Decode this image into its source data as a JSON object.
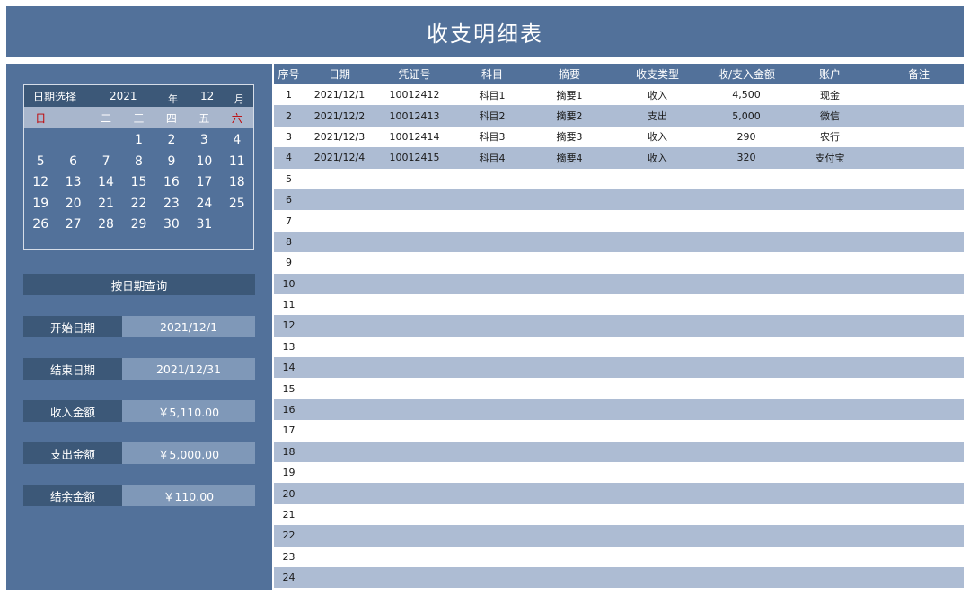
{
  "title": "收支明细表",
  "calendar": {
    "label": "日期选择",
    "year": "2021",
    "year_unit": "年",
    "month": "12",
    "month_unit": "月",
    "weekdays": [
      "日",
      "一",
      "二",
      "三",
      "四",
      "五",
      "六"
    ],
    "cells": [
      "",
      "",
      "",
      "1",
      "2",
      "3",
      "4",
      "5",
      "6",
      "7",
      "8",
      "9",
      "10",
      "11",
      "12",
      "13",
      "14",
      "15",
      "16",
      "17",
      "18",
      "19",
      "20",
      "21",
      "22",
      "23",
      "24",
      "25",
      "26",
      "27",
      "28",
      "29",
      "30",
      "31",
      "",
      ""
    ]
  },
  "query_button": "按日期查询",
  "summary": [
    {
      "label": "开始日期",
      "value": "2021/12/1"
    },
    {
      "label": "结束日期",
      "value": "2021/12/31"
    },
    {
      "label": "收入金额",
      "value": "￥5,110.00"
    },
    {
      "label": "支出金额",
      "value": "￥5,000.00"
    },
    {
      "label": "结余金额",
      "value": "￥110.00"
    }
  ],
  "table": {
    "headers": [
      "序号",
      "日期",
      "凭证号",
      "科目",
      "摘要",
      "收支类型",
      "收/支入金额",
      "账户",
      "备注"
    ],
    "rows": [
      [
        "1",
        "2021/12/1",
        "10012412",
        "科目1",
        "摘要1",
        "收入",
        "4,500",
        "现金",
        ""
      ],
      [
        "2",
        "2021/12/2",
        "10012413",
        "科目2",
        "摘要2",
        "支出",
        "5,000",
        "微信",
        ""
      ],
      [
        "3",
        "2021/12/3",
        "10012414",
        "科目3",
        "摘要3",
        "收入",
        "290",
        "农行",
        ""
      ],
      [
        "4",
        "2021/12/4",
        "10012415",
        "科目4",
        "摘要4",
        "收入",
        "320",
        "支付宝",
        ""
      ],
      [
        "5",
        "",
        "",
        "",
        "",
        "",
        "",
        "",
        ""
      ],
      [
        "6",
        "",
        "",
        "",
        "",
        "",
        "",
        "",
        ""
      ],
      [
        "7",
        "",
        "",
        "",
        "",
        "",
        "",
        "",
        ""
      ],
      [
        "8",
        "",
        "",
        "",
        "",
        "",
        "",
        "",
        ""
      ],
      [
        "9",
        "",
        "",
        "",
        "",
        "",
        "",
        "",
        ""
      ],
      [
        "10",
        "",
        "",
        "",
        "",
        "",
        "",
        "",
        ""
      ],
      [
        "11",
        "",
        "",
        "",
        "",
        "",
        "",
        "",
        ""
      ],
      [
        "12",
        "",
        "",
        "",
        "",
        "",
        "",
        "",
        ""
      ],
      [
        "13",
        "",
        "",
        "",
        "",
        "",
        "",
        "",
        ""
      ],
      [
        "14",
        "",
        "",
        "",
        "",
        "",
        "",
        "",
        ""
      ],
      [
        "15",
        "",
        "",
        "",
        "",
        "",
        "",
        "",
        ""
      ],
      [
        "16",
        "",
        "",
        "",
        "",
        "",
        "",
        "",
        ""
      ],
      [
        "17",
        "",
        "",
        "",
        "",
        "",
        "",
        "",
        ""
      ],
      [
        "18",
        "",
        "",
        "",
        "",
        "",
        "",
        "",
        ""
      ],
      [
        "19",
        "",
        "",
        "",
        "",
        "",
        "",
        "",
        ""
      ],
      [
        "20",
        "",
        "",
        "",
        "",
        "",
        "",
        "",
        ""
      ],
      [
        "21",
        "",
        "",
        "",
        "",
        "",
        "",
        "",
        ""
      ],
      [
        "22",
        "",
        "",
        "",
        "",
        "",
        "",
        "",
        ""
      ],
      [
        "23",
        "",
        "",
        "",
        "",
        "",
        "",
        "",
        ""
      ],
      [
        "24",
        "",
        "",
        "",
        "",
        "",
        "",
        "",
        ""
      ]
    ]
  }
}
